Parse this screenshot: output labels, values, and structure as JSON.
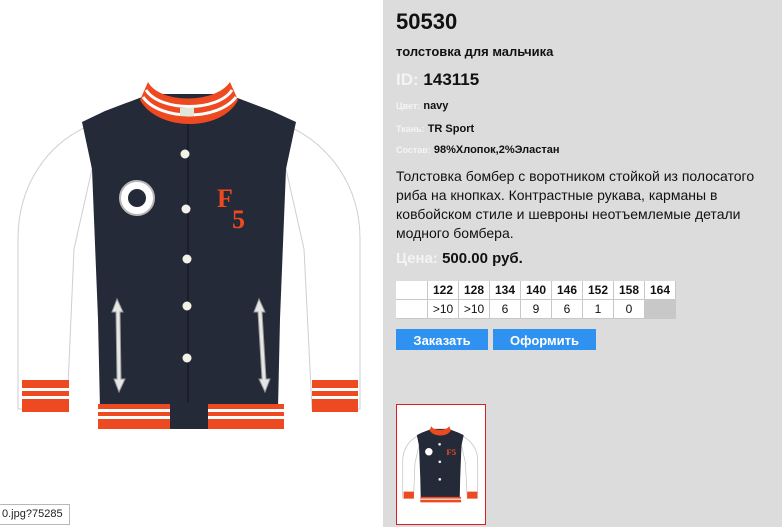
{
  "product": {
    "code": "50530",
    "name": "толстовка для мальчика",
    "id_label": "ID:",
    "id_value": "143115",
    "attributes": [
      {
        "label": "Цвет:",
        "value": "navy"
      },
      {
        "label": "Ткань:",
        "value": "TR Sport"
      },
      {
        "label": "Состав:",
        "value": "98%Хлопок,2%Эластан"
      }
    ],
    "description": "Толстовка бомбер с воротником стойкой из полосатого риба на кнопках. Контрастные рукава, карманы в ковбойском стиле и шевроны неотъемлемые детали модного бомбера.",
    "price_label": "Цена:",
    "price_value": "500.00 руб."
  },
  "sizes": {
    "headers": [
      "122",
      "128",
      "134",
      "140",
      "146",
      "152",
      "158",
      "164"
    ],
    "quantities": [
      ">10",
      ">10",
      "6",
      "9",
      "6",
      "1",
      "0",
      ""
    ]
  },
  "buttons": {
    "order": "Заказать",
    "checkout": "Оформить"
  },
  "status_bar": {
    "url": "0.jpg?75285"
  },
  "colors": {
    "right_panel_bg": "#dcdcdc",
    "button_bg": "#2f92f0",
    "thumb_border": "#d81e1e",
    "jacket_body": "#252a38",
    "jacket_trim": "#ee4a22",
    "jacket_sleeve": "#ffffff"
  }
}
